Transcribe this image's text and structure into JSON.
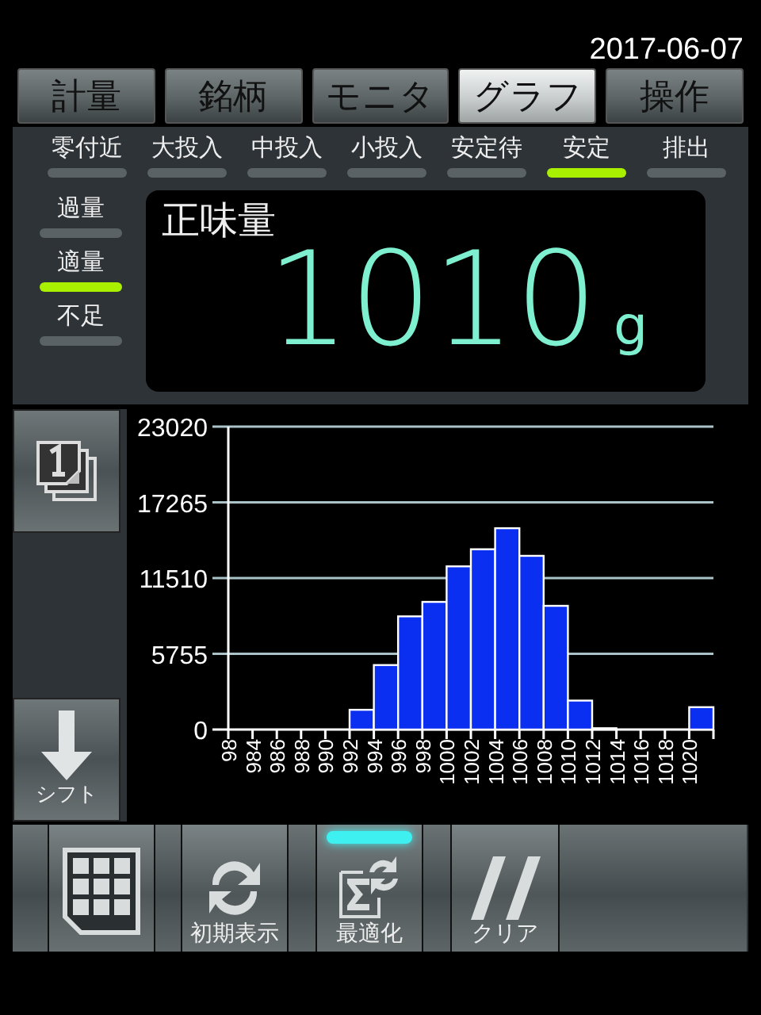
{
  "date": "2017-06-07",
  "tabs": [
    {
      "label": "計量",
      "selected": false
    },
    {
      "label": "銘柄",
      "selected": false
    },
    {
      "label": "モニタ",
      "selected": false
    },
    {
      "label": "グラフ",
      "selected": true
    },
    {
      "label": "操作",
      "selected": false
    }
  ],
  "status_lamps": [
    {
      "label": "零付近",
      "on": false
    },
    {
      "label": "大投入",
      "on": false
    },
    {
      "label": "中投入",
      "on": false
    },
    {
      "label": "小投入",
      "on": false
    },
    {
      "label": "安定待",
      "on": false
    },
    {
      "label": "安定",
      "on": true
    },
    {
      "label": "排出",
      "on": false
    }
  ],
  "judgement": [
    {
      "label": "過量",
      "on": false
    },
    {
      "label": "適量",
      "on": true
    },
    {
      "label": "不足",
      "on": false
    }
  ],
  "display": {
    "label": "正味量",
    "value": "1010",
    "unit": "g"
  },
  "side_buttons": [
    {
      "kind": "page"
    },
    {
      "kind": "shift",
      "label": "シフト"
    }
  ],
  "chart_data": {
    "type": "bar",
    "categories": [
      "98",
      "984",
      "986",
      "988",
      "990",
      "992",
      "994",
      "996",
      "998",
      "1000",
      "1002",
      "1004",
      "1006",
      "1008",
      "1010",
      "1012",
      "1014",
      "1016",
      "1018",
      "1020"
    ],
    "series": [
      {
        "color": "#0a2ff0",
        "values": [
          0,
          0,
          0,
          0,
          0,
          1500,
          4900,
          8600,
          9700,
          12400,
          13700,
          15300,
          13200,
          9400,
          2200,
          100,
          0,
          0,
          0,
          1700
        ]
      }
    ],
    "grid": true,
    "ylim": [
      0,
      23020
    ],
    "yticks": [
      0,
      5755,
      11510,
      17265,
      23020
    ]
  },
  "toolbar": [
    {
      "kind": "grid",
      "active": false
    },
    {
      "kind": "reset",
      "label": "初期表示",
      "active": false
    },
    {
      "kind": "optimize",
      "label": "最適化",
      "active": true
    },
    {
      "kind": "clear",
      "label": "クリア",
      "active": false
    }
  ]
}
